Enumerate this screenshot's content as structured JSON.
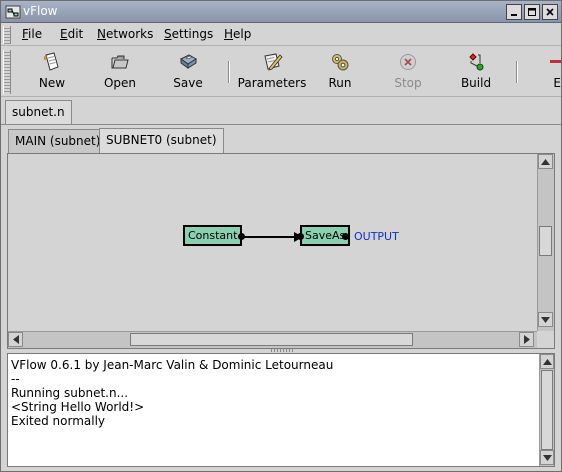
{
  "window": {
    "title": "vFlow"
  },
  "menu": [
    {
      "label": "File",
      "u": "F",
      "rest": "ile"
    },
    {
      "label": "Edit",
      "u": "E",
      "rest": "dit"
    },
    {
      "label": "Networks",
      "u": "N",
      "rest": "etworks"
    },
    {
      "label": "Settings",
      "u": "S",
      "rest": "ettings"
    },
    {
      "label": "Help",
      "u": "H",
      "rest": "elp"
    }
  ],
  "toolbar": {
    "new": "New",
    "open": "Open",
    "save": "Save",
    "parameters": "Parameters",
    "run": "Run",
    "stop": "Stop",
    "build": "Build",
    "overflow": "E"
  },
  "document_tab": "subnet.n",
  "subnet_tabs": [
    "MAIN (subnet)",
    "SUBNET0 (subnet)"
  ],
  "network": {
    "nodes": [
      {
        "name": "Constant"
      },
      {
        "name": "SaveAs"
      }
    ],
    "output_label": "OUTPUT"
  },
  "console": {
    "lines": [
      "VFlow 0.6.1 by Jean-Marc Valin & Dominic Letourneau",
      "--",
      "Running subnet.n...",
      "<String Hello World!>",
      "Exited normally"
    ]
  },
  "colors": {
    "node_fill": "#89d0b0",
    "output_label": "#1030d0",
    "titlebar": "#98a2b8"
  }
}
